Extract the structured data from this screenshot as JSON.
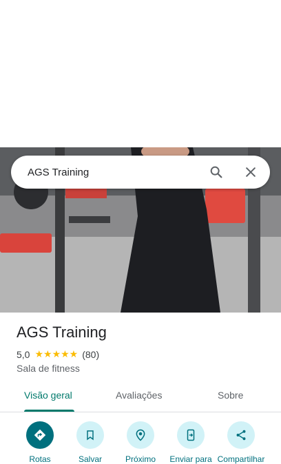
{
  "search": {
    "query": "AGS Training"
  },
  "place": {
    "name": "AGS Training",
    "rating": "5,0",
    "stars": "★★★★★",
    "review_count": "(80)",
    "category": "Sala de fitness"
  },
  "tabs": [
    {
      "label": "Visão geral",
      "active": true
    },
    {
      "label": "Avaliações",
      "active": false
    },
    {
      "label": "Sobre",
      "active": false
    }
  ],
  "actions": [
    {
      "label": "Rotas",
      "icon": "directions-icon"
    },
    {
      "label": "Salvar",
      "icon": "bookmark-icon"
    },
    {
      "label": "Próximo",
      "icon": "nearby-icon"
    },
    {
      "label": "Enviar para",
      "icon": "send-to-phone-icon"
    },
    {
      "label": "Compartilhar",
      "icon": "share-icon"
    }
  ],
  "colors": {
    "accent": "#00707e",
    "tab_active": "#00796b",
    "star": "#fbbc04"
  }
}
